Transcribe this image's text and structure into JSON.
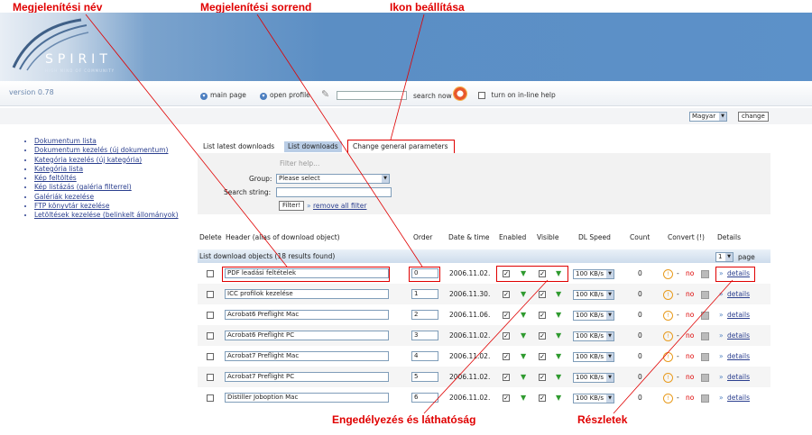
{
  "callouts": {
    "name": "Megjelenítési név",
    "order": "Megjelenítési sorrend",
    "icon": "Ikon beállítása",
    "enable": "Engedélyezés és láthatóság",
    "details": "Részletek"
  },
  "logo": {
    "title": "SPIRIT",
    "subtitle": "HIGH MIND OF COMMUNITY"
  },
  "version": "version 0.78",
  "topnav": {
    "main_page": "main page",
    "open_profile": "open profile",
    "search_now": "search now",
    "inline_help": "turn on in-line help"
  },
  "lang": {
    "selected": "Magyar",
    "change": "change"
  },
  "sidebar": {
    "items": [
      "Dokumentum lista",
      "Dokumentum kezelés (új dokumentum)",
      "Kategória kezelés (új kategória)",
      "Kategória lista",
      "Kép feltöltés",
      "Kép listázás (galéria filterrel)",
      "Galériák kezelése",
      "FTP könyvtár kezelése",
      "Letöltések kezelése (belinkelt állományok)"
    ]
  },
  "tabs": [
    "List latest downloads",
    "List downloads",
    "Change general parameters"
  ],
  "filter": {
    "help": "Filter help...",
    "group_label": "Group:",
    "group_value": "Please select",
    "search_label": "Search string:",
    "filter_btn": "Filter!",
    "remove_all": "remove all filter"
  },
  "table": {
    "headers": [
      "Delete",
      "Header (alias of download object)",
      "Order",
      "Date & time",
      "Enabled",
      "Visible",
      "DL Speed",
      "Count",
      "Convert (!)",
      "Details"
    ],
    "list_caption": "List download objects (18 results found)",
    "page_value": "1",
    "page_label": "page",
    "rows": [
      {
        "header": "PDF leadási feltételek",
        "order": "0",
        "date": "2006.11.02.",
        "speed": "100 KB/s",
        "count": "0",
        "no": "no",
        "details": "details"
      },
      {
        "header": "ICC profilok kezelése",
        "order": "1",
        "date": "2006.11.30.",
        "speed": "100 KB/s",
        "count": "0",
        "no": "no",
        "details": "details"
      },
      {
        "header": "Acrobat6 Preflight Mac",
        "order": "2",
        "date": "2006.11.06.",
        "speed": "100 KB/s",
        "count": "0",
        "no": "no",
        "details": "details"
      },
      {
        "header": "Acrobat6 Preflight PC",
        "order": "3",
        "date": "2006.11.02.",
        "speed": "100 KB/s",
        "count": "0",
        "no": "no",
        "details": "details"
      },
      {
        "header": "Acrobat7 Preflight Mac",
        "order": "4",
        "date": "2006.11.02.",
        "speed": "100 KB/s",
        "count": "0",
        "no": "no",
        "details": "details"
      },
      {
        "header": "Acrobat7 Preflight PC",
        "order": "5",
        "date": "2006.11.02.",
        "speed": "100 KB/s",
        "count": "0",
        "no": "no",
        "details": "details"
      },
      {
        "header": "Distiller Joboption Mac",
        "order": "6",
        "date": "2006.11.02.",
        "speed": "100 KB/s",
        "count": "0",
        "no": "no",
        "details": "details"
      }
    ]
  },
  "colors": {
    "callout": "#e00000",
    "banner": "#5b8ec4",
    "active_tab": "#b9cde6",
    "flag": "#2f9a2f"
  }
}
